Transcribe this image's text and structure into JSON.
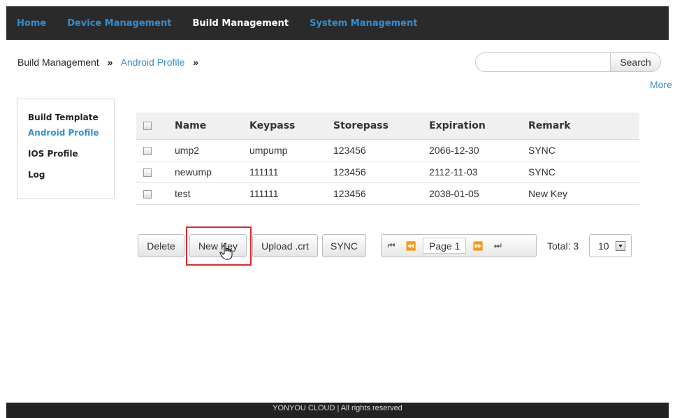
{
  "nav": {
    "items": [
      {
        "label": "Home"
      },
      {
        "label": "Device Management"
      },
      {
        "label": "Build Management"
      },
      {
        "label": "System Management"
      }
    ],
    "active": "Build Management",
    "accent_color": "#2f8fd8"
  },
  "breadcrumb": {
    "root": "Build Management",
    "sep": "»",
    "current": "Android Profile"
  },
  "search": {
    "placeholder": "",
    "button_label": "Search"
  },
  "more_link": "More",
  "sidebar": {
    "items": [
      {
        "label": "Build Template"
      },
      {
        "label": "Android Profile"
      },
      {
        "label": "IOS Profile"
      },
      {
        "label": "Log"
      }
    ],
    "active": "Android Profile"
  },
  "table": {
    "columns": [
      "Name",
      "Keypass",
      "Storepass",
      "Expiration",
      "Remark"
    ],
    "rows": [
      {
        "name": "ump2",
        "keypass": "umpump",
        "storepass": "123456",
        "expiration": "2066-12-30",
        "remark": "SYNC"
      },
      {
        "name": "newump",
        "keypass": "111111",
        "storepass": "123456",
        "expiration": "2112-11-03",
        "remark": "SYNC"
      },
      {
        "name": "test",
        "keypass": "111111",
        "storepass": "123456",
        "expiration": "2038-01-05",
        "remark": "New Key"
      }
    ]
  },
  "toolbar": {
    "delete": "Delete",
    "new_key": "New Key",
    "upload": "Upload .crt",
    "sync": "SYNC"
  },
  "pager": {
    "page_label": "Page 1",
    "total_label": "Total: 3",
    "page_size": "10"
  },
  "footer": "YONYOU CLOUD | All rights reserved",
  "highlight_color": "#e3262b"
}
